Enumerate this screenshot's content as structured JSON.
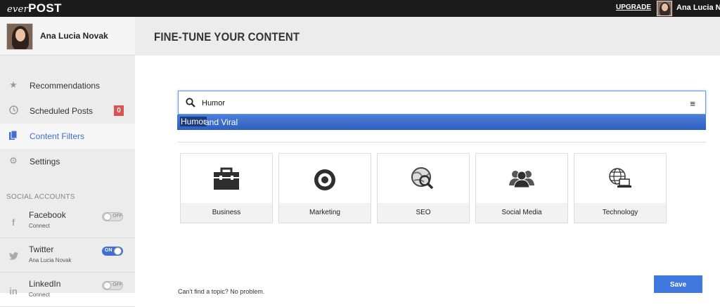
{
  "topbar": {
    "logo_ever": "ever",
    "logo_post": "POST",
    "upgrade": "UPGRADE",
    "user_name": "Ana Lucia Novak"
  },
  "sidebar": {
    "user_name": "Ana Lucia Novak",
    "nav": [
      {
        "label": "Recommendations",
        "icon": "star-icon"
      },
      {
        "label": "Scheduled Posts",
        "icon": "clock-icon",
        "badge": "0"
      },
      {
        "label": "Content Filters",
        "icon": "documents-icon",
        "active": true
      },
      {
        "label": "Settings",
        "icon": "gear-icon"
      }
    ],
    "section_title": "SOCIAL ACCOUNTS",
    "accounts": [
      {
        "name": "Facebook",
        "sub": "Connect",
        "toggle": "OFF",
        "icon": "facebook-icon"
      },
      {
        "name": "Twitter",
        "sub": "Ana Lucia Novak",
        "toggle": "ON",
        "icon": "twitter-icon"
      },
      {
        "name": "LinkedIn",
        "sub": "Connect",
        "toggle": "OFF",
        "icon": "linkedin-icon"
      }
    ]
  },
  "main": {
    "title": "FINE-TUNE YOUR CONTENT",
    "search": {
      "value": "Humor",
      "suggestion_highlight": "Humor",
      "suggestion_rest": " and Viral"
    },
    "topics": [
      {
        "label": "Business",
        "icon": "briefcase-icon"
      },
      {
        "label": "Marketing",
        "icon": "target-icon"
      },
      {
        "label": "SEO",
        "icon": "globe-magnifier-icon"
      },
      {
        "label": "Social Media",
        "icon": "people-icon"
      },
      {
        "label": "Technology",
        "icon": "globe-laptop-icon"
      }
    ],
    "bottom_text": "Can't find a topic? No problem.",
    "save_label": "Save"
  },
  "colors": {
    "accent": "#3f6fd1",
    "topbar": "#1b1b1b",
    "badge": "#d9534f",
    "suggest": "#3a6ccf"
  }
}
